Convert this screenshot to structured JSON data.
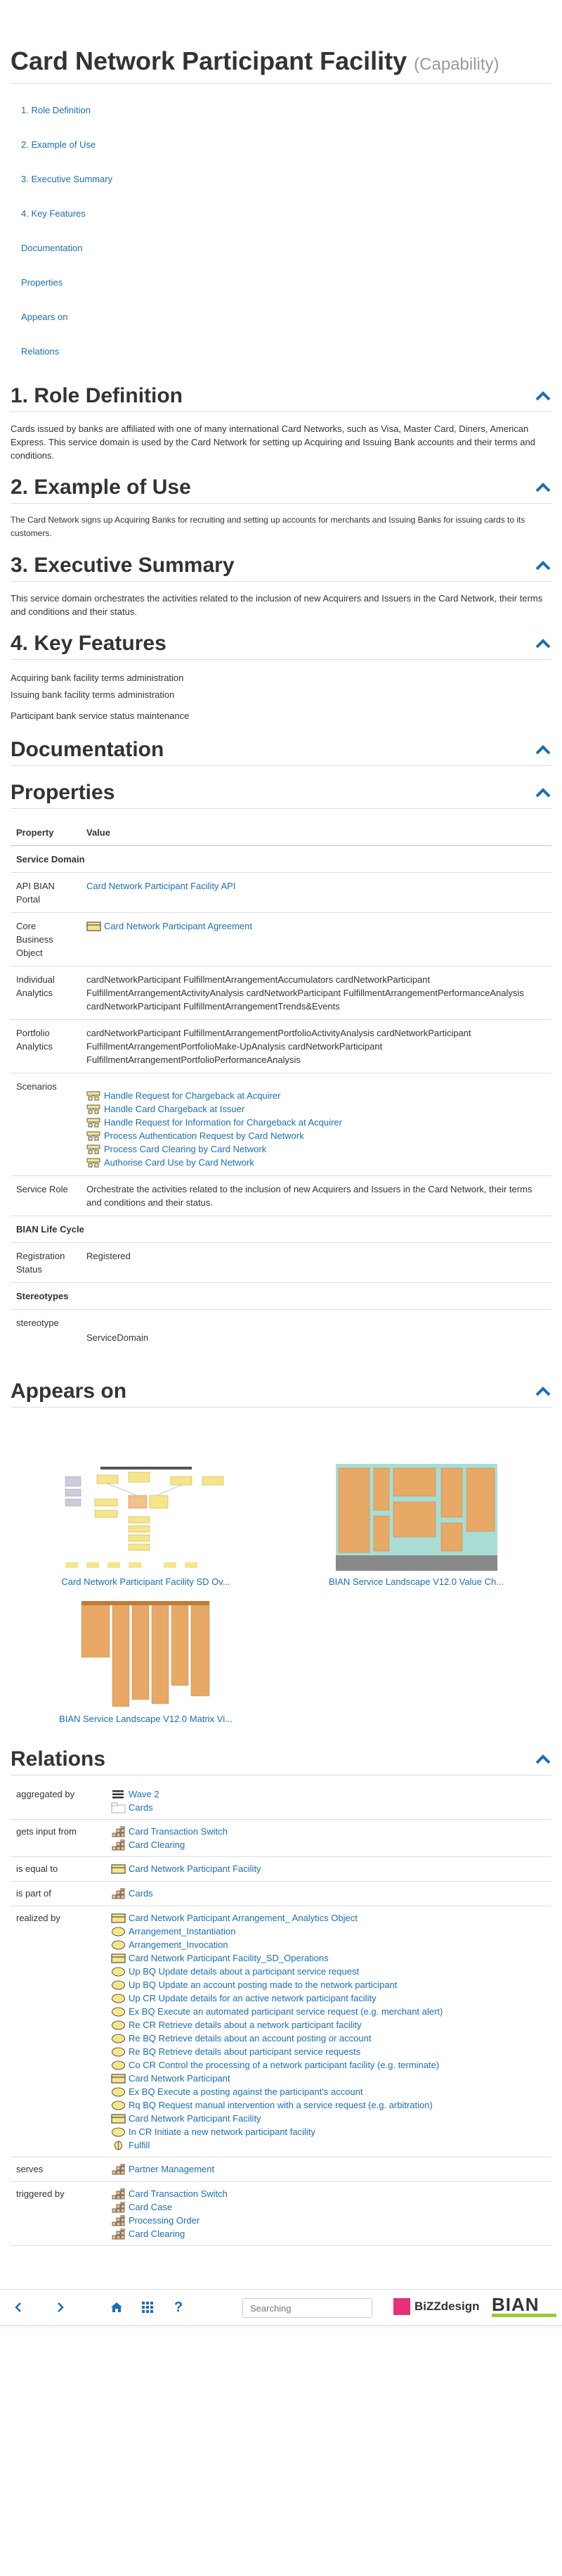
{
  "page": {
    "title": "Card Network Participant Facility",
    "subtitle": "(Capability)"
  },
  "toc": [
    "1. Role Definition",
    "2. Example of Use",
    "3. Executive Summary",
    "4. Key Features",
    "Documentation",
    "Properties",
    "Appears on",
    "Relations"
  ],
  "sections": {
    "role_definition": {
      "heading": "1. Role Definition",
      "text": "Cards issued by banks are affiliated with one of many international Card Networks, such as Visa, Master Card, Diners, American Express. This service domain is used by the Card Network for setting up Acquiring and Issuing Bank accounts and their terms and conditions."
    },
    "example_of_use": {
      "heading": "2. Example of Use",
      "text": "The Card Network signs up Acquiring Banks for recruiting and setting up accounts for merchants and Issuing Banks for issuing cards to its customers."
    },
    "executive_summary": {
      "heading": "3. Executive Summary",
      "text": "This service domain orchestrates the activities related to the inclusion of new Acquirers and Issuers in the Card Network, their terms and conditions and their status."
    },
    "key_features": {
      "heading": "4. Key Features",
      "items": [
        "Acquiring bank facility terms administration",
        "Issuing bank facility terms administration",
        "Participant bank service status maintenance"
      ]
    },
    "documentation": {
      "heading": "Documentation"
    },
    "properties": {
      "heading": "Properties"
    },
    "appears_on": {
      "heading": "Appears on"
    },
    "relations": {
      "heading": "Relations"
    }
  },
  "properties": {
    "col_property": "Property",
    "col_value": "Value",
    "group_service_domain": "Service Domain",
    "api_label": "API BIAN Portal",
    "api_value": "Card Network Participant Facility API",
    "core_label": "Core Business Object",
    "core_value": "Card Network Participant Agreement",
    "individual_label": "Individual Analytics",
    "individual_value": "cardNetworkParticipant FulfillmentArrangementAccumulators cardNetworkParticipant FulfillmentArrangementActivityAnalysis cardNetworkParticipant FulfillmentArrangementPerformanceAnalysis cardNetworkParticipant FulfillmentArrangementTrends&Events",
    "portfolio_label": "Portfolio Analytics",
    "portfolio_value": "cardNetworkParticipant FulfillmentArrangementPortfolioActivityAnalysis cardNetworkParticipant FulfillmentArrangementPortfolioMake-UpAnalysis cardNetworkParticipant FulfillmentArrangementPortfolioPerformanceAnalysis",
    "scenarios_label": "Scenarios",
    "scenarios": [
      "Handle Request for Chargeback at Acquirer",
      "Handle Card Chargeback at Issuer",
      "Handle Request for Information for Chargeback at Acquirer",
      "Process Authentication Request by Card Network",
      "Process Card Clearing by Card Network",
      "Authorise Card Use by Card Network"
    ],
    "service_role_label": "Service Role",
    "service_role_value": "Orchestrate the activities related to the inclusion of new Acquirers and Issuers in the Card Network, their terms and conditions and their status.",
    "group_lifecycle": "BIAN Life Cycle",
    "registration_label": "Registration Status",
    "registration_value": "Registered",
    "group_stereotypes": "Stereotypes",
    "stereotype_label": "stereotype",
    "stereotype_value": "ServiceDomain"
  },
  "appears_on": [
    "Card Network Participant Facility SD Ov...",
    "BIAN Service Landscape V12.0 Value Ch...",
    "BIAN Service Landscape V12.0 Matrix Vi..."
  ],
  "relations": {
    "aggregated_by": {
      "label": "aggregated by",
      "items": [
        "Wave 2",
        "Cards"
      ]
    },
    "gets_input_from": {
      "label": "gets input from",
      "items": [
        "Card Transaction Switch",
        "Card Clearing"
      ]
    },
    "is_equal_to": {
      "label": "is equal to",
      "items": [
        "Card Network Participant Facility"
      ]
    },
    "is_part_of": {
      "label": "is part of",
      "items": [
        "Cards"
      ]
    },
    "realized_by": {
      "label": "realized by",
      "items": [
        "Card Network Participant Arrangement_ Analytics Object",
        "Arrangement_Instantiation",
        "Arrangement_Invocation",
        "Card Network Participant Facility_SD_Operations",
        "Up BQ Update details about a participant service request",
        "Up BQ Update an account posting made to the network participant",
        "Up CR Update details for an active network participant facility",
        "Ex BQ Execute an automated participant service request (e.g. merchant alert)",
        "Re CR Retrieve details about a network participant facility",
        "Re BQ Retrieve details about an account posting or account",
        "Re BQ Retrieve details about participant service requests",
        "Co CR Control the processing of a network participant facility (e.g. terminate)",
        "Card Network Participant",
        "Ex BQ Execute a posting against the participant's account",
        "Rq BQ Request manual intervention with a service request (e.g. arbitration)",
        "Card Network Participant Facility",
        "In CR Initiate a new network participant facility",
        "Fulfill"
      ]
    },
    "serves": {
      "label": "serves",
      "items": [
        "Partner Management"
      ]
    },
    "triggered_by": {
      "label": "triggered by",
      "items": [
        "Card Transaction Switch",
        "Card Case",
        "Processing Order",
        "Card Clearing"
      ]
    }
  },
  "toolbar": {
    "search_placeholder": "Searching",
    "bizzdesign": "BiZZdesign",
    "bian": "BIAN"
  },
  "colors": {
    "link": "#1b6eb5",
    "heading": "#333333",
    "accent_green": "#9ac93e",
    "bizz_pink": "#e6307a"
  }
}
